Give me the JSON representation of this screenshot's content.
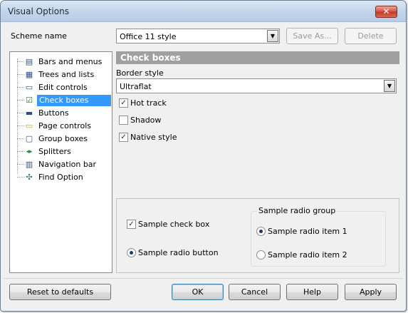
{
  "window": {
    "title": "Visual Options",
    "close_glyph": "✕"
  },
  "scheme": {
    "label": "Scheme name",
    "value": "Office 11 style",
    "save_as": "Save As...",
    "delete": "Delete"
  },
  "tree": {
    "items": [
      {
        "label": "Bars and menus",
        "icon": "bars-menus-icon",
        "glyph": "▤"
      },
      {
        "label": "Trees and lists",
        "icon": "tree-list-icon",
        "glyph": "▦"
      },
      {
        "label": "Edit controls",
        "icon": "edit-control-icon",
        "glyph": "▭"
      },
      {
        "label": "Check boxes",
        "icon": "checkbox-icon",
        "glyph": "☑",
        "selected": true
      },
      {
        "label": "Buttons",
        "icon": "button-icon",
        "glyph": "▬"
      },
      {
        "label": "Page controls",
        "icon": "page-control-icon",
        "glyph": "▭"
      },
      {
        "label": "Group boxes",
        "icon": "group-box-icon",
        "glyph": "▢"
      },
      {
        "label": "Splitters",
        "icon": "splitter-icon",
        "glyph": "◂▸"
      },
      {
        "label": "Navigation bar",
        "icon": "navigation-bar-icon",
        "glyph": "▥"
      },
      {
        "label": "Find Option",
        "icon": "find-option-icon",
        "glyph": "✣"
      }
    ]
  },
  "panel": {
    "header": "Check boxes",
    "border_style_label": "Border style",
    "border_style_value": "Ultraflat",
    "hot_track": {
      "label": "Hot track",
      "checked": true
    },
    "shadow": {
      "label": "Shadow",
      "checked": false
    },
    "native_style": {
      "label": "Native style",
      "checked": true
    }
  },
  "sample": {
    "check_box_label": "Sample check box",
    "radio_button_label": "Sample radio button",
    "group_title": "Sample radio group",
    "radio_item_1": "Sample radio item 1",
    "radio_item_2": "Sample radio item 2"
  },
  "buttons": {
    "reset": "Reset to defaults",
    "ok": "OK",
    "cancel": "Cancel",
    "help": "Help",
    "apply": "Apply"
  },
  "colors": {
    "selection": "#3399ff",
    "header": "#a0a0a0",
    "close_button": "#c23a2a"
  }
}
